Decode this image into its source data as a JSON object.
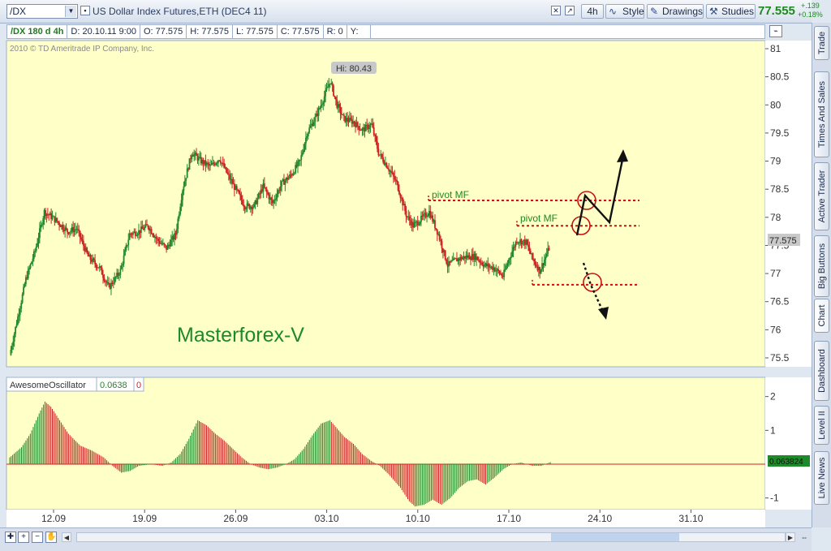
{
  "toolbar": {
    "symbol": "/DX",
    "title": "US Dollar Index Futures,ETH (DEC4 11)",
    "timeframe": "4h",
    "style_label": "Style",
    "drawings_label": "Drawings",
    "studies_label": "Studies",
    "last_price": "77.555",
    "change": "+.139",
    "change_pct": "+0.18%"
  },
  "infobar": {
    "symbol_period": "/DX 180 d 4h",
    "date": "D: 20.10.11 9:00",
    "open": "O: 77.575",
    "high": "H: 77.575",
    "low": "L: 77.575",
    "close": "C: 77.575",
    "range": "R: 0",
    "y": "Y:"
  },
  "sidetabs": [
    "Trade",
    "Times And Sales",
    "Active Trader",
    "Big Buttons",
    "Chart",
    "Dashboard",
    "Level II",
    "Live News"
  ],
  "colors": {
    "up": "#1f8a2a",
    "down": "#cc2222",
    "panel_bg": "#ffffc8",
    "pivot_line": "#cc1111",
    "watermark": "#1d8a2a"
  },
  "chart_data": [
    {
      "type": "candlestick",
      "copyright": "2010 © TD Ameritrade IP Company, Inc.",
      "watermark": "Masterforex-V",
      "hi_label": "Hi: 80.43",
      "price_label": "77.575",
      "pivot_labels": [
        "pivot MF",
        "pivot MF"
      ],
      "ylim": [
        75.3,
        81.3
      ],
      "y_ticks": [
        "81",
        "80.5",
        "80",
        "79.5",
        "79",
        "78.5",
        "78",
        "77.5",
        "77",
        "76.5",
        "76",
        "75.5"
      ],
      "x_ticks": [
        "12.09",
        "19.09",
        "26.09",
        "03.10",
        "10.10",
        "17.10",
        "24.10",
        "31.10"
      ],
      "close_path": [
        [
          0,
          75.55
        ],
        [
          14,
          76.9
        ],
        [
          22,
          77.4
        ],
        [
          30,
          78.1
        ],
        [
          40,
          77.95
        ],
        [
          50,
          77.75
        ],
        [
          58,
          77.8
        ],
        [
          68,
          77.3
        ],
        [
          78,
          77.1
        ],
        [
          86,
          76.75
        ],
        [
          96,
          77.05
        ],
        [
          104,
          77.7
        ],
        [
          112,
          77.75
        ],
        [
          120,
          77.85
        ],
        [
          128,
          77.6
        ],
        [
          136,
          77.45
        ],
        [
          144,
          77.7
        ],
        [
          150,
          78.5
        ],
        [
          158,
          79.15
        ],
        [
          166,
          79.0
        ],
        [
          174,
          78.9
        ],
        [
          182,
          79.05
        ],
        [
          188,
          78.8
        ],
        [
          196,
          78.5
        ],
        [
          204,
          78.2
        ],
        [
          212,
          78.2
        ],
        [
          220,
          78.55
        ],
        [
          228,
          78.25
        ],
        [
          236,
          78.6
        ],
        [
          244,
          78.75
        ],
        [
          252,
          79.0
        ],
        [
          258,
          79.5
        ],
        [
          266,
          79.8
        ],
        [
          272,
          80.1
        ],
        [
          278,
          80.43
        ],
        [
          284,
          80.0
        ],
        [
          290,
          79.75
        ],
        [
          298,
          79.7
        ],
        [
          306,
          79.55
        ],
        [
          314,
          79.65
        ],
        [
          320,
          79.15
        ],
        [
          328,
          78.9
        ],
        [
          336,
          78.6
        ],
        [
          344,
          78.05
        ],
        [
          350,
          77.85
        ],
        [
          356,
          77.95
        ],
        [
          364,
          78.1
        ],
        [
          372,
          77.7
        ],
        [
          380,
          77.15
        ],
        [
          388,
          77.25
        ],
        [
          396,
          77.3
        ],
        [
          404,
          77.3
        ],
        [
          412,
          77.15
        ],
        [
          420,
          77.1
        ],
        [
          428,
          76.95
        ],
        [
          434,
          77.3
        ],
        [
          440,
          77.6
        ],
        [
          448,
          77.55
        ],
        [
          454,
          77.25
        ],
        [
          460,
          77.05
        ],
        [
          468,
          77.45
        ]
      ],
      "pivots": [
        {
          "label": "pivot MF",
          "level": 78.3
        },
        {
          "label": "pivot MF",
          "level": 77.85
        },
        {
          "label": "",
          "level": 76.8
        }
      ]
    },
    {
      "type": "bar",
      "title": "AwesomeOscillator",
      "value_label": "0.0638",
      "zero_label": "0",
      "last_value_label": "0.063824",
      "ylim": [
        -1.4,
        2.15
      ],
      "y_ticks": [
        "2",
        "1",
        "-1"
      ],
      "values_path": [
        [
          0,
          0.2
        ],
        [
          8,
          0.5
        ],
        [
          14,
          0.9
        ],
        [
          20,
          1.5
        ],
        [
          24,
          1.85
        ],
        [
          28,
          1.7
        ],
        [
          34,
          1.3
        ],
        [
          40,
          0.9
        ],
        [
          48,
          0.55
        ],
        [
          56,
          0.4
        ],
        [
          64,
          0.2
        ],
        [
          70,
          -0.05
        ],
        [
          76,
          -0.25
        ],
        [
          82,
          -0.2
        ],
        [
          88,
          -0.05
        ],
        [
          96,
          0.0
        ],
        [
          104,
          -0.05
        ],
        [
          110,
          0.05
        ],
        [
          116,
          0.3
        ],
        [
          122,
          0.75
        ],
        [
          128,
          1.3
        ],
        [
          134,
          1.15
        ],
        [
          140,
          0.9
        ],
        [
          146,
          0.7
        ],
        [
          152,
          0.45
        ],
        [
          158,
          0.2
        ],
        [
          164,
          0.0
        ],
        [
          170,
          -0.1
        ],
        [
          176,
          -0.15
        ],
        [
          182,
          -0.1
        ],
        [
          188,
          0.0
        ],
        [
          194,
          0.15
        ],
        [
          200,
          0.45
        ],
        [
          206,
          0.85
        ],
        [
          212,
          1.2
        ],
        [
          218,
          1.3
        ],
        [
          222,
          1.1
        ],
        [
          228,
          0.8
        ],
        [
          234,
          0.6
        ],
        [
          240,
          0.3
        ],
        [
          246,
          0.1
        ],
        [
          252,
          -0.05
        ],
        [
          258,
          -0.3
        ],
        [
          266,
          -0.7
        ],
        [
          272,
          -1.1
        ],
        [
          276,
          -1.25
        ],
        [
          282,
          -1.2
        ],
        [
          288,
          -1.05
        ],
        [
          294,
          -1.2
        ],
        [
          300,
          -1.0
        ],
        [
          306,
          -0.7
        ],
        [
          312,
          -0.5
        ],
        [
          318,
          -0.45
        ],
        [
          324,
          -0.6
        ],
        [
          330,
          -0.4
        ],
        [
          336,
          -0.15
        ],
        [
          342,
          -0.0
        ],
        [
          348,
          0.05
        ],
        [
          356,
          -0.05
        ],
        [
          362,
          -0.05
        ],
        [
          368,
          0.06
        ]
      ]
    }
  ],
  "bottombar": {
    "zoom_in": "+",
    "zoom_out": "−"
  }
}
